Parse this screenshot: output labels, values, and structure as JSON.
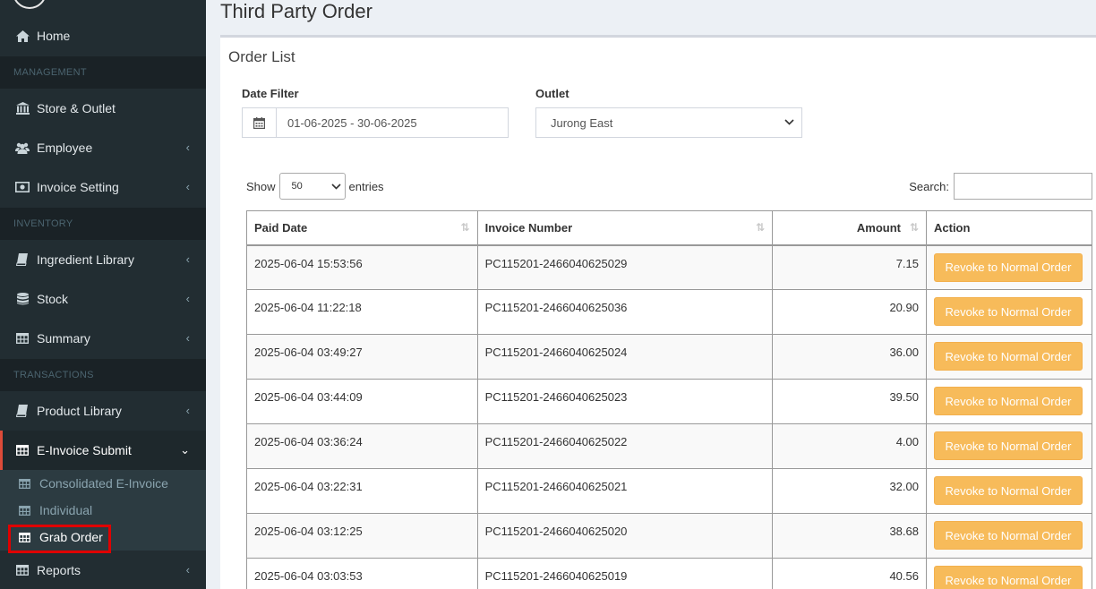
{
  "sidebar": {
    "items": {
      "home": "Home",
      "store_outlet": "Store & Outlet",
      "employee": "Employee",
      "invoice_setting": "Invoice Setting",
      "ingredient_library": "Ingredient Library",
      "stock": "Stock",
      "summary": "Summary",
      "product_library": "Product Library",
      "einvoice_submit": "E-Invoice Submit",
      "reports": "Reports"
    },
    "headers": {
      "management": "MANAGEMENT",
      "inventory": "INVENTORY",
      "transactions": "TRANSACTIONS"
    },
    "submenu": {
      "consolidated": "Consolidated E-Invoice",
      "individual": "Individual",
      "grab_order": "Grab Order"
    }
  },
  "page": {
    "title": "Third Party Order",
    "box_title": "Order List"
  },
  "filters": {
    "date_label": "Date Filter",
    "date_value": "01-06-2025 - 30-06-2025",
    "outlet_label": "Outlet",
    "outlet_value": "Jurong East"
  },
  "table_controls": {
    "show_label": "Show",
    "entries_value": "50",
    "entries_label": "entries",
    "search_label": "Search:"
  },
  "table": {
    "headers": {
      "paid_date": "Paid Date",
      "invoice_number": "Invoice Number",
      "amount": "Amount",
      "action": "Action"
    },
    "action_label": "Revoke to Normal Order",
    "rows": [
      {
        "paid_date": "2025-06-04 15:53:56",
        "invoice": "PC115201-2466040625029",
        "amount": "7.15"
      },
      {
        "paid_date": "2025-06-04 11:22:18",
        "invoice": "PC115201-2466040625036",
        "amount": "20.90"
      },
      {
        "paid_date": "2025-06-04 03:49:27",
        "invoice": "PC115201-2466040625024",
        "amount": "36.00"
      },
      {
        "paid_date": "2025-06-04 03:44:09",
        "invoice": "PC115201-2466040625023",
        "amount": "39.50"
      },
      {
        "paid_date": "2025-06-04 03:36:24",
        "invoice": "PC115201-2466040625022",
        "amount": "4.00"
      },
      {
        "paid_date": "2025-06-04 03:22:31",
        "invoice": "PC115201-2466040625021",
        "amount": "32.00"
      },
      {
        "paid_date": "2025-06-04 03:12:25",
        "invoice": "PC115201-2466040625020",
        "amount": "38.68"
      },
      {
        "paid_date": "2025-06-04 03:03:53",
        "invoice": "PC115201-2466040625019",
        "amount": "40.56"
      }
    ]
  },
  "colors": {
    "sidebar_bg": "#222d32",
    "active_border": "#dd4b39",
    "revoke_button": "#f7bb5a",
    "highlight": "#e00000"
  }
}
